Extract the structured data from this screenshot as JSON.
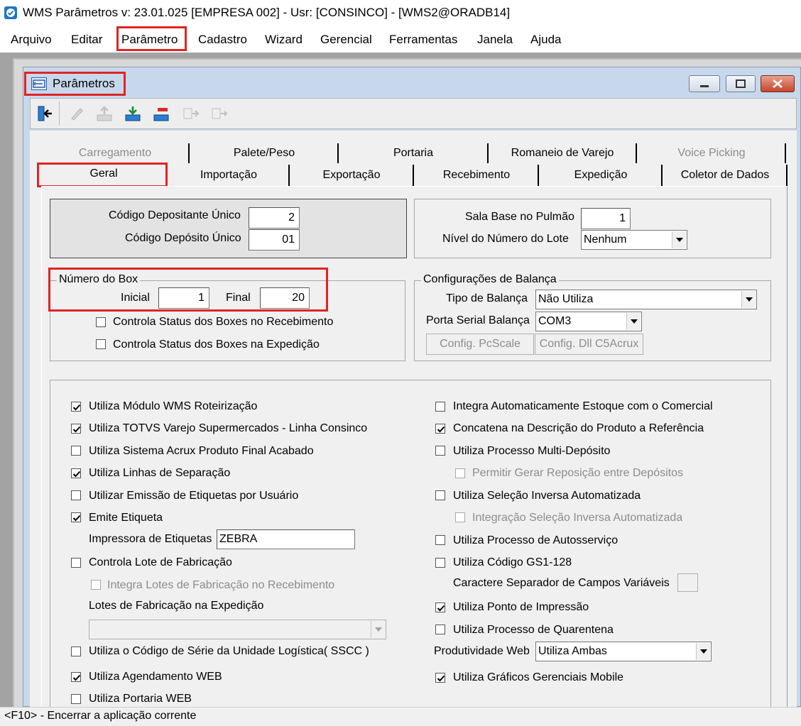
{
  "window": {
    "title": "WMS Parâmetros  v: 23.01.025   [EMPRESA 002] - Usr: [CONSINCO] - [WMS2@ORADB14]"
  },
  "menu": [
    "Arquivo",
    "Editar",
    "Parâmetro",
    "Cadastro",
    "Wizard",
    "Gerencial",
    "Ferramentas",
    "Janela",
    "Ajuda"
  ],
  "child": {
    "title": "Parâmetros"
  },
  "tabs": {
    "row1": [
      "Carregamento",
      "Palete/Peso",
      "Portaria",
      "Romaneio de Varejo",
      "Voice Picking"
    ],
    "row2": [
      "Geral",
      "Importação",
      "Exportação",
      "Recebimento",
      "Expedição",
      "Coletor de Dados"
    ]
  },
  "top": {
    "cod_depositante_label": "Código Depositante Único",
    "cod_depositante_value": "2",
    "cod_deposito_label": "Código Depósito Único",
    "cod_deposito_value": "01",
    "sala_base_label": "Sala Base no Pulmão",
    "sala_base_value": "1",
    "nivel_lote_label": "Nível do Número do Lote",
    "nivel_lote_value": "Nenhum"
  },
  "box": {
    "legend": "Número do Box",
    "inicial_label": "Inicial",
    "inicial_value": "1",
    "final_label": "Final",
    "final_value": "20",
    "chk_receb": "Controla Status dos Boxes no Recebimento",
    "chk_exped": "Controla Status dos Boxes na Expedição"
  },
  "balanca": {
    "legend": "Configurações de Balança",
    "tipo_label": "Tipo de Balança",
    "tipo_value": "Não Utiliza",
    "porta_label": "Porta Serial Balança",
    "porta_value": "COM3",
    "btn_pcscale": "Config. PcScale",
    "btn_dll": "Config. Dll C5Acrux"
  },
  "left_options": {
    "roteirizacao": "Utiliza Módulo WMS Roteirização",
    "totvs": "Utiliza TOTVS Varejo Supermercados - Linha Consinco",
    "acrux": "Utiliza Sistema Acrux Produto Final Acabado",
    "linhas": "Utiliza Linhas de Separação",
    "etiq_usuario": "Utilizar Emissão de Etiquetas por Usuário",
    "emite_etiqueta": "Emite Etiqueta",
    "impressora_label": "Impressora de Etiquetas",
    "impressora_value": "ZEBRA",
    "lote_fab": "Controla Lote de Fabricação",
    "integra_lotes": "Integra  Lotes de Fabricação no Recebimento",
    "lotes_exped_label": "Lotes de Fabricação na Expedição",
    "sscc": "Utiliza o Código de Série da Unidade Logística( SSCC )",
    "agendamento": "Utiliza Agendamento WEB",
    "portaria_web": "Utiliza Portaria WEB"
  },
  "right_options": {
    "integra_estoque": "Integra Automaticamente Estoque com o Comercial",
    "concatena": "Concatena na Descrição do Produto a Referência",
    "multi_deposito": "Utiliza Processo Multi-Depósito",
    "permitir_repos": "Permitir Gerar Reposição entre Depósitos",
    "selecao_inversa": "Utiliza Seleção Inversa Automatizada",
    "integracao_selecao": "Integração Seleção Inversa Automatizada",
    "autosservico": "Utiliza Processo de Autosserviço",
    "gs1": "Utiliza Código GS1-128",
    "caractere_sep": "Caractere Separador de Campos Variáveis",
    "ponto_impressao": "Utiliza Ponto de Impressão",
    "quarentena": "Utiliza Processo de Quarentena",
    "produtividade_label": "Produtividade Web",
    "produtividade_value": "Utiliza Ambas",
    "graficos": "Utiliza Gráficos Gerenciais Mobile"
  },
  "status": "<F10> - Encerrar a aplicação corrente"
}
